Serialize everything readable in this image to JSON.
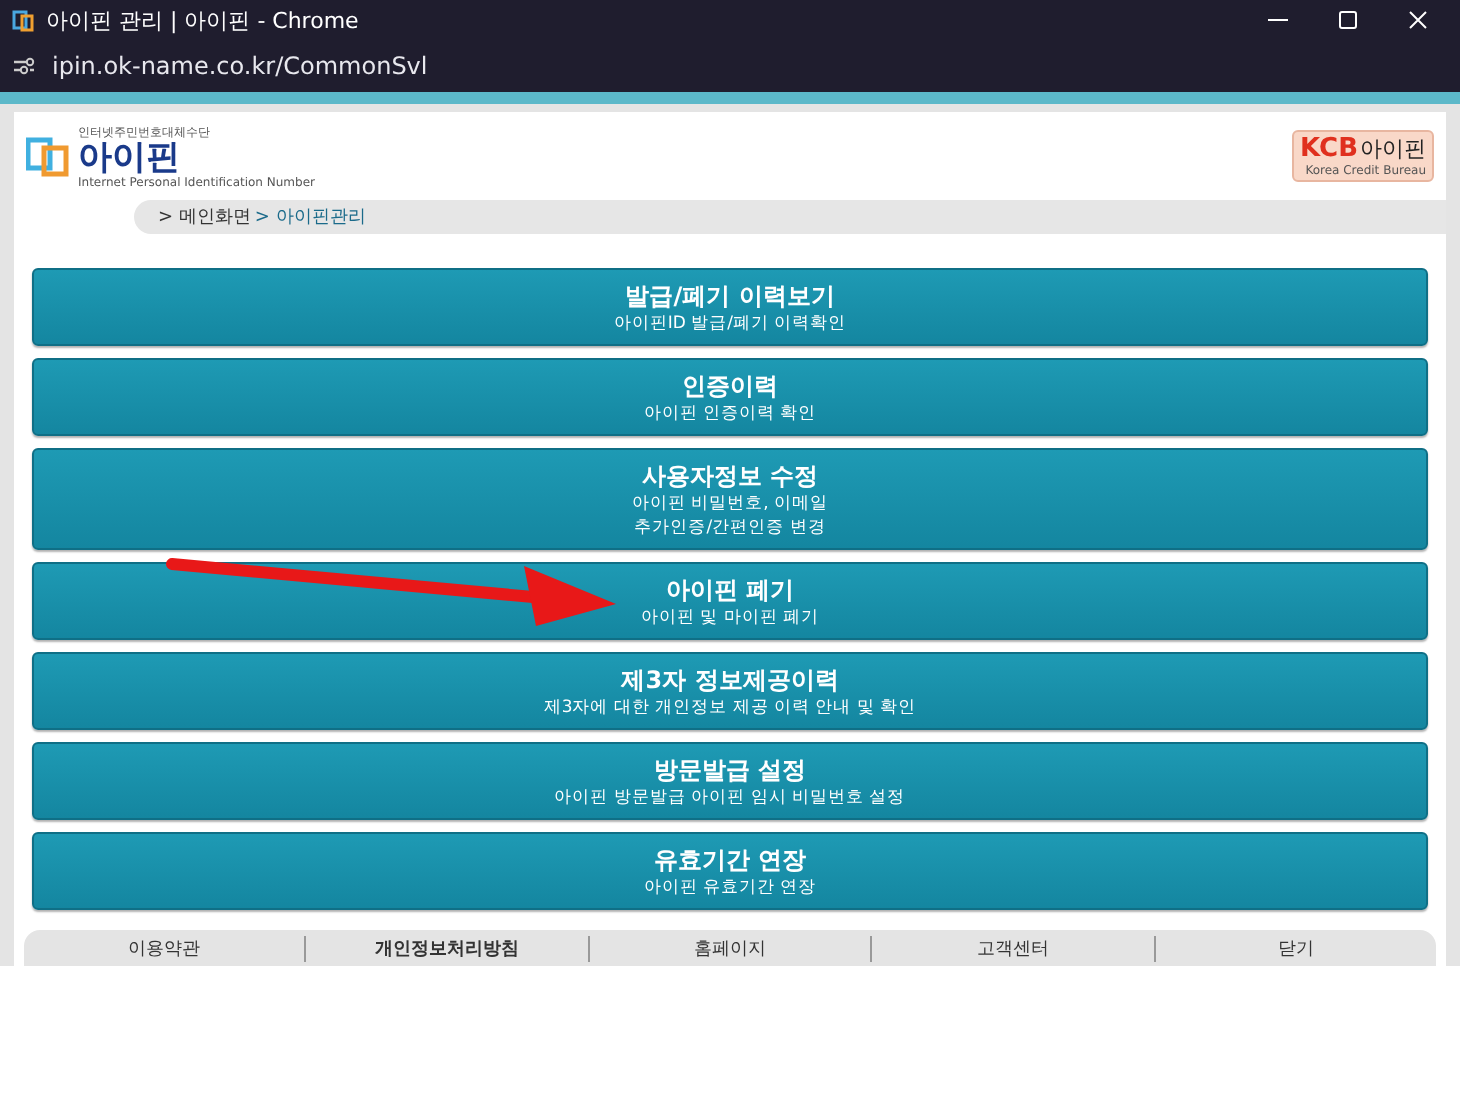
{
  "window": {
    "title": "아이핀 관리 | 아이핀 - Chrome",
    "url": "ipin.ok-name.co.kr/CommonSvl"
  },
  "header": {
    "tagline": "인터넷주민번호대체수단",
    "logo_text": "아이핀",
    "logo_subtext": "Internet Personal Identification Number",
    "partner_brand": "KCB",
    "partner_name": "아이핀",
    "partner_subtext": "Korea Credit Bureau"
  },
  "breadcrumb": [
    {
      "prefix": ">",
      "label": "메인화면",
      "selected": false
    },
    {
      "prefix": ">",
      "label": "아이핀관리",
      "selected": true
    }
  ],
  "menu": [
    {
      "title": "발급/폐기 이력보기",
      "lines": [
        "아이핀ID 발급/폐기 이력확인"
      ]
    },
    {
      "title": "인증이력",
      "lines": [
        "아이핀 인증이력 확인"
      ]
    },
    {
      "title": "사용자정보 수정",
      "lines": [
        "아이핀 비밀번호, 이메일",
        "추가인증/간편인증 변경"
      ]
    },
    {
      "title": "아이핀 폐기",
      "lines": [
        "아이핀 및 마이핀 폐기"
      ]
    },
    {
      "title": "제3자 정보제공이력",
      "lines": [
        "제3자에 대한 개인정보 제공 이력 안내 및 확인"
      ]
    },
    {
      "title": "방문발급 설정",
      "lines": [
        "아이핀 방문발급 아이핀 임시 비밀번호 설정"
      ]
    },
    {
      "title": "유효기간 연장",
      "lines": [
        "아이핀 유효기간 연장"
      ]
    }
  ],
  "footer": [
    {
      "label": "이용약관",
      "bold": false
    },
    {
      "label": "개인정보처리방침",
      "bold": true
    },
    {
      "label": "홈페이지",
      "bold": false
    },
    {
      "label": "고객센터",
      "bold": false
    },
    {
      "label": "닫기",
      "bold": false
    }
  ],
  "annotation": {
    "kind": "arrow"
  }
}
